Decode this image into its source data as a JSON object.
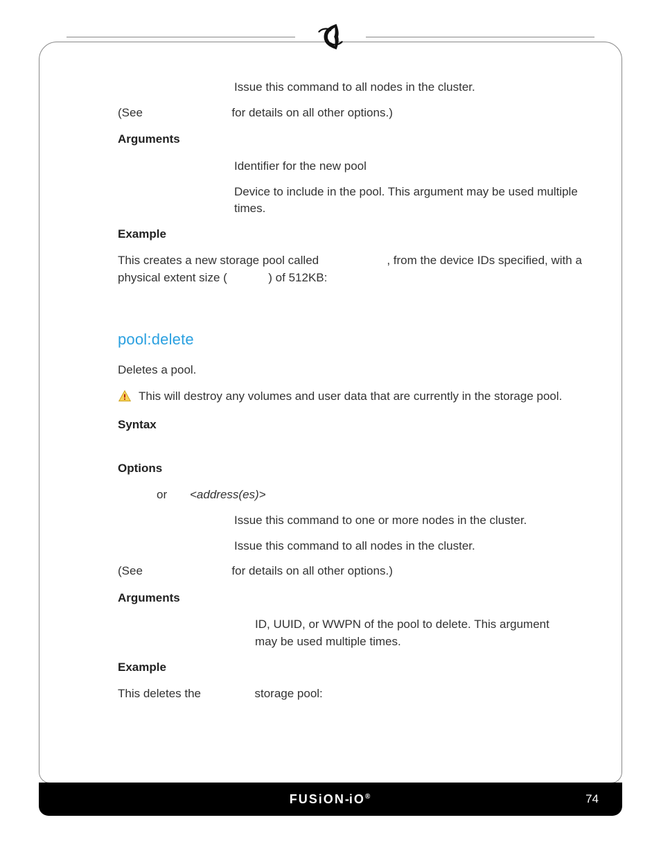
{
  "top": {
    "opt_all_desc": "Issue this command to all nodes in the cluster.",
    "see": "(See",
    "see_rest": "for details on all other options.)",
    "arguments_h": "Arguments",
    "arg_name_desc": "Identifier for the new pool",
    "arg_device_desc": "Device to include in the pool. This argument may be used multiple times.",
    "example_h": "Example",
    "ex_a": "This creates a new storage pool called",
    "ex_b": ", from the device IDs specified, with a physical extent size (",
    "ex_c": ") of 512KB:"
  },
  "pooldelete": {
    "title": "pool:delete",
    "desc": "Deletes a pool.",
    "warn": "This will destroy any volumes and user data that are currently in the storage pool.",
    "syntax_h": "Syntax",
    "options_h": "Options",
    "opt_or": "or",
    "opt_arg": "<address(es)>",
    "opt_node_desc": "Issue this command to one or more nodes in the cluster.",
    "opt_all_desc": "Issue this command to all nodes in the cluster.",
    "see": "(See",
    "see_rest": "for details on all other options.)",
    "arguments_h": "Arguments",
    "arg_pool_desc": "ID, UUID, or WWPN of the pool to delete. This argument may be used multiple times.",
    "example_h": "Example",
    "ex_a": "This deletes the",
    "ex_b": "storage pool:"
  },
  "footer": {
    "brand": "FUSiON-iO",
    "page": "74"
  }
}
